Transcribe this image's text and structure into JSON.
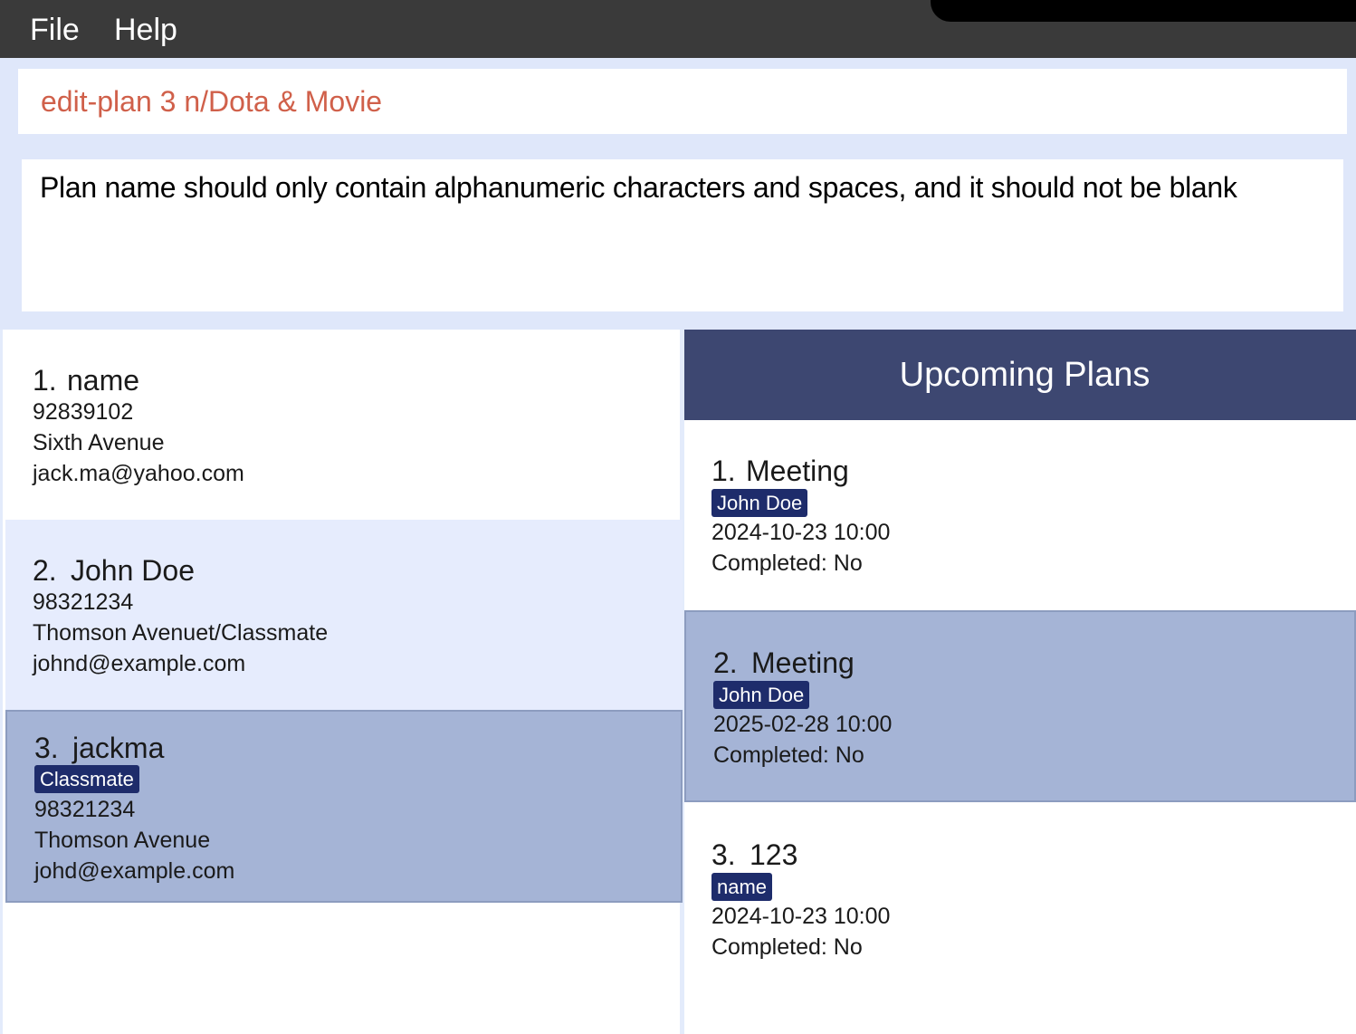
{
  "menu": {
    "file": "File",
    "help": "Help"
  },
  "command": {
    "value": "edit-plan 3 n/Dota & Movie"
  },
  "result": {
    "text": "Plan name should only contain alphanumeric characters and spaces, and it should not be blank"
  },
  "persons": [
    {
      "index": "1.",
      "name": "name",
      "tag": "",
      "phone": "92839102",
      "address": "Sixth Avenue",
      "email": "jack.ma@yahoo.com"
    },
    {
      "index": "2.",
      "name": "John Doe",
      "tag": "",
      "phone": "98321234",
      "address": "Thomson Avenuet/Classmate",
      "email": "johnd@example.com"
    },
    {
      "index": "3.",
      "name": "jackma",
      "tag": "Classmate",
      "phone": "98321234",
      "address": "Thomson Avenue",
      "email": "johd@example.com"
    }
  ],
  "plans_panel": {
    "title": "Upcoming Plans",
    "plans": [
      {
        "index": "1.",
        "name": "Meeting",
        "tag": "John Doe",
        "datetime": "2024-10-23 10:00",
        "completed": "Completed: No"
      },
      {
        "index": "2.",
        "name": "Meeting",
        "tag": "John Doe",
        "datetime": "2025-02-28 10:00",
        "completed": "Completed: No"
      },
      {
        "index": "3.",
        "name": "123",
        "tag": "name",
        "datetime": "2024-10-23 10:00",
        "completed": "Completed: No"
      }
    ]
  },
  "colors": {
    "menubar": "#3a3a3a",
    "command_text": "#d0604a",
    "panel_bg": "#dfe7fa",
    "selected_bg": "#a5b4d6",
    "tag_bg": "#1e2c6b",
    "header_bg": "#3d4771"
  }
}
